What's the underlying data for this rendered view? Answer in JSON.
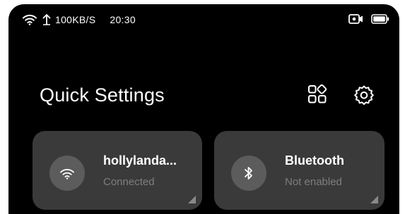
{
  "status_bar": {
    "speed": "100KB/S",
    "time": "20:30",
    "icons": [
      "wifi-icon",
      "upload-arrow-icon",
      "video-record-icon",
      "battery-icon"
    ]
  },
  "header": {
    "title": "Quick Settings",
    "icons": [
      "apps-grid-icon",
      "settings-gear-icon"
    ]
  },
  "tiles": [
    {
      "name": "hollylanda...",
      "status": "Connected",
      "icon": "wifi-icon"
    },
    {
      "name": "Bluetooth",
      "status": "Not enabled",
      "icon": "bluetooth-icon"
    }
  ],
  "colors": {
    "background": "#000000",
    "tile": "#3a3a3a",
    "tile_icon_circle": "#5c5c5c",
    "text_primary": "#ffffff",
    "text_secondary": "#7e7e7e"
  }
}
